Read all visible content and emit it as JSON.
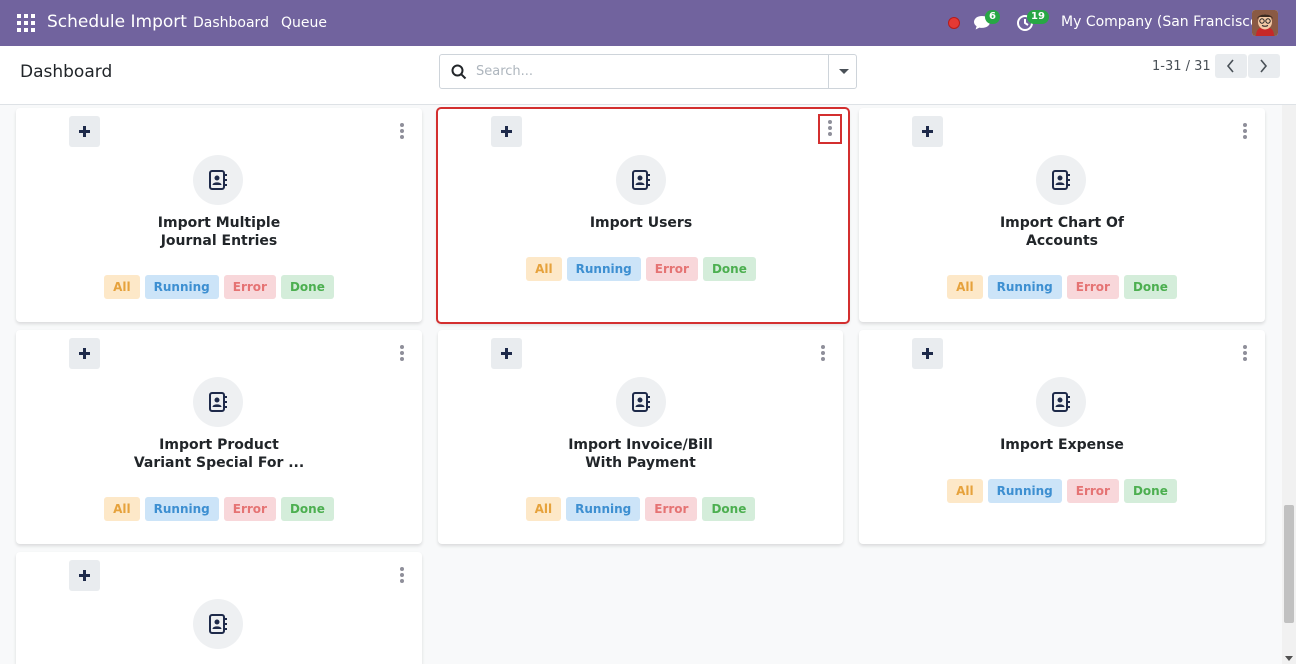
{
  "navbar": {
    "app_title": "Schedule Import",
    "links": [
      "Dashboard",
      "Queue"
    ],
    "messages_count": "6",
    "activities_count": "19",
    "company": "My Company (San Francisco)"
  },
  "control_panel": {
    "title": "Dashboard",
    "search_placeholder": "Search...",
    "pager": "1-31 / 31"
  },
  "cards": [
    {
      "title_line1": "Import Multiple",
      "title_line2": "Journal Entries"
    },
    {
      "title_line1": "Import Users",
      "title_line2": ""
    },
    {
      "title_line1": "Import Chart Of",
      "title_line2": "Accounts"
    },
    {
      "title_line1": "Import Product",
      "title_line2": "Variant Special For ..."
    },
    {
      "title_line1": "Import Invoice/Bill",
      "title_line2": "With Payment"
    },
    {
      "title_line1": "Import Expense",
      "title_line2": ""
    },
    {
      "title_line1": "",
      "title_line2": ""
    }
  ],
  "chips": {
    "all": "All",
    "running": "Running",
    "error": "Error",
    "done": "Done"
  },
  "colors": {
    "navbar": "#71639e",
    "selection_outline": "#d32f2f"
  }
}
